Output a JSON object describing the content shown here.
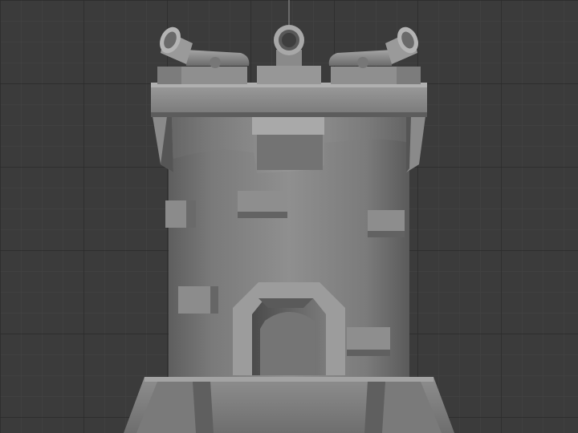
{
  "viewport": {
    "background_color": "#3b3b3b",
    "grid": true,
    "grid_minor_color": "#424242",
    "grid_major_color": "#2c2c2c"
  },
  "model": {
    "subject": "tower",
    "material_color": "#8c8c8c",
    "parts": [
      "cannon-left-icon",
      "cannon-center-icon",
      "cannon-right-icon",
      "parapet",
      "tower-body",
      "arched-door",
      "stone-blocks",
      "base-plinth"
    ]
  }
}
